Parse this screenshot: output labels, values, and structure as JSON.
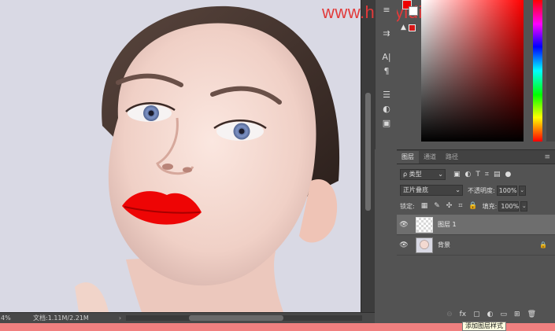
{
  "watermark": {
    "text": "www.haoyidiansheji.com"
  },
  "colors": {
    "foreground": "#e00000",
    "background": "#ffffff",
    "accent_red": "#e23a3a",
    "lip_red": "#ee0505"
  },
  "status_bar": {
    "zoom": "4%",
    "doc_info": "文档:1.11M/2.21M",
    "arrow": "›"
  },
  "mini_tools": [
    {
      "icon": "brush-settings-icon",
      "glyph": "≡"
    },
    {
      "icon": "adjust-sliders-icon",
      "glyph": "⇉"
    },
    {
      "icon": "character-icon",
      "glyph": "A|"
    },
    {
      "icon": "paragraph-icon",
      "glyph": "¶"
    },
    {
      "icon": "properties-icon",
      "glyph": "☰"
    },
    {
      "icon": "adjustments-icon",
      "glyph": "◐"
    },
    {
      "icon": "libraries-icon",
      "glyph": "▣"
    }
  ],
  "gamut_warning_glyph": "▲",
  "layers_panel": {
    "tabs": [
      {
        "label": "图层",
        "active": true
      },
      {
        "label": "通道",
        "active": false
      },
      {
        "label": "路径",
        "active": false
      }
    ],
    "menu_glyph": "≡",
    "kind_filter": {
      "label": "ρ 类型",
      "arrow": "⌄"
    },
    "filter_icons": [
      "▣",
      "◐",
      "T",
      "⌗",
      "▤",
      "●"
    ],
    "blend_mode": {
      "label": "正片叠底",
      "arrow": "⌄"
    },
    "opacity": {
      "label": "不透明度:",
      "value": "100%",
      "arrow": "⌄"
    },
    "lock": {
      "label": "锁定:",
      "icons": [
        "▦",
        "✎",
        "✣",
        "⌗",
        "🔒"
      ]
    },
    "fill": {
      "label": "填充:",
      "value": "100%",
      "arrow": "⌄"
    },
    "layers": [
      {
        "name": "图层 1",
        "visible": true,
        "selected": true,
        "locked": false
      },
      {
        "name": "背景",
        "visible": true,
        "selected": false,
        "locked": true
      }
    ],
    "eye_glyph": "👁",
    "lock_glyph": "🔒",
    "footer_icons": [
      "⊖",
      "fx",
      "▢",
      "◐",
      "▭",
      "⊞",
      "🗑"
    ],
    "tooltip": "添加图层样式"
  }
}
